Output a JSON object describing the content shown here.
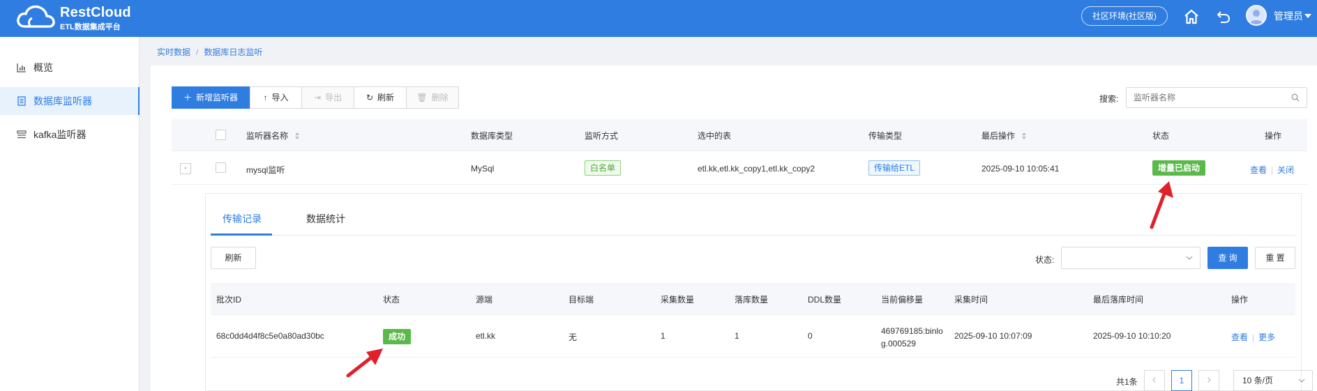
{
  "header": {
    "logo_title": "RestCloud",
    "logo_subtitle": "ETL数据集成平台",
    "env_label": "社区环境(社区版)",
    "user_name": "管理员"
  },
  "sidebar": {
    "items": [
      {
        "label": "概览",
        "icon": "bar-chart-icon",
        "active": false
      },
      {
        "label": "数据库监听器",
        "icon": "document-list-icon",
        "active": true
      },
      {
        "label": "kafka监听器",
        "icon": "stack-icon",
        "active": false
      }
    ]
  },
  "breadcrumb": [
    "实时数据",
    "数据库日志监听"
  ],
  "toolbar": {
    "add": "新增监听器",
    "import": "导入",
    "export": "导出",
    "refresh": "刷新",
    "delete": "删除"
  },
  "search": {
    "label": "搜索:",
    "placeholder": "监听器名称"
  },
  "listener_table": {
    "columns": [
      "监听器名称",
      "数据库类型",
      "监听方式",
      "选中的表",
      "传输类型",
      "最后操作",
      "状态",
      "操作"
    ],
    "rows": [
      {
        "expand": "-",
        "name": "mysql监听",
        "db_type": "MySql",
        "mode": "白名单",
        "tables": "etl.kk,etl.kk_copy1,etl.kk_copy2",
        "transfer": "传输给ETL",
        "last_op": "2025-09-10 10:05:41",
        "status": "增量已启动",
        "action_view": "查看",
        "action_close": "关闭"
      }
    ]
  },
  "detail": {
    "tabs": [
      "传输记录",
      "数据统计"
    ],
    "refresh": "刷新",
    "status_label": "状态:",
    "status_value": "",
    "query": "查 询",
    "reset": "重 置",
    "columns": [
      "批次ID",
      "状态",
      "源端",
      "目标端",
      "采集数量",
      "落库数量",
      "DDL数量",
      "当前偏移量",
      "采集时间",
      "最后落库时间",
      "操作"
    ],
    "rows": [
      {
        "batch_id": "68c0dd4d4f8c5e0a80ad30bc",
        "status": "成功",
        "source": "etl.kk",
        "target": "无",
        "collected": "1",
        "stored": "1",
        "ddl": "0",
        "offset": "469769185:binlog.000529",
        "collect_time": "2025-09-10 10:07:09",
        "store_time": "2025-09-10 10:10:20",
        "action_view": "查看",
        "action_more": "更多"
      }
    ],
    "pagination": {
      "total": "共1条",
      "current": "1",
      "page_size": "10 条/页"
    }
  },
  "colors": {
    "primary": "#2f7de1",
    "success": "#5ab94a",
    "arrow": "#e0202a"
  }
}
